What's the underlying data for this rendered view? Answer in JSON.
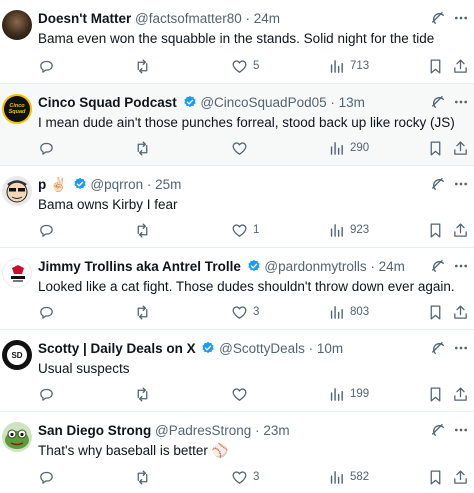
{
  "colors": {
    "text_primary": "#0f1419",
    "text_secondary": "#536471",
    "verified_blue": "#1d9bf0",
    "divider": "#e6ecf0",
    "highlight_bg": "#f7f9f9"
  },
  "tweets": [
    {
      "name": "Doesn't Matter",
      "handle": "@factsofmatter80",
      "dot": "·",
      "time": "24m",
      "verified": false,
      "text": "Bama even won the squabble in the stands. Solid night for the tide",
      "replies": "",
      "retweets": "",
      "likes": "5",
      "views": "713",
      "highlight": false,
      "avatar": "dark-photo"
    },
    {
      "name": "Cinco Squad Podcast",
      "handle": "@CincoSquadPod05",
      "dot": "·",
      "time": "13m",
      "verified": true,
      "text": "I mean dude ain't those punches forreal, stood back up like rocky (JS)",
      "replies": "",
      "retweets": "",
      "likes": "",
      "views": "290",
      "highlight": true,
      "avatar": "logo-yellow-black",
      "avatar_text": "Cinco Squad"
    },
    {
      "name": "p",
      "name_emoji": "✌🏻",
      "handle": "@pqrron",
      "dot": "·",
      "time": "25m",
      "verified": true,
      "text": "Bama owns Kirby I fear",
      "replies": "",
      "retweets": "",
      "likes": "1",
      "views": "923",
      "highlight": false,
      "avatar": "cartoon-face"
    },
    {
      "name": "Jimmy Trollins aka Antrel Trolle",
      "handle": "@pardonmytrolls",
      "dot": "·",
      "time": "24m",
      "verified": true,
      "text": "Looked like a cat fight. Those dudes shouldn't throw down ever again.",
      "replies": "",
      "retweets": "",
      "likes": "3",
      "views": "803",
      "highlight": false,
      "avatar": "logo-white"
    },
    {
      "name": "Scotty | Daily Deals on X",
      "handle": "@ScottyDeals",
      "dot": "·",
      "time": "10m",
      "verified": true,
      "text": "Usual suspects",
      "replies": "",
      "retweets": "",
      "likes": "",
      "views": "199",
      "highlight": false,
      "avatar": "logo-dark",
      "avatar_text": "SD"
    },
    {
      "name": "San Diego Strong",
      "handle": "@PadresStrong",
      "dot": "·",
      "time": "23m",
      "verified": false,
      "text": "That's why baseball is better",
      "text_emoji": "⚾",
      "replies": "",
      "retweets": "",
      "likes": "3",
      "views": "582",
      "highlight": false,
      "avatar": "frog-green"
    }
  ],
  "icons": {
    "reply": "reply-icon",
    "retweet": "retweet-icon",
    "like": "heart-icon",
    "views": "views-icon",
    "bookmark": "bookmark-icon",
    "share": "share-icon",
    "grok": "grok-icon",
    "more": "more-icon",
    "verified": "verified-badge-icon"
  }
}
